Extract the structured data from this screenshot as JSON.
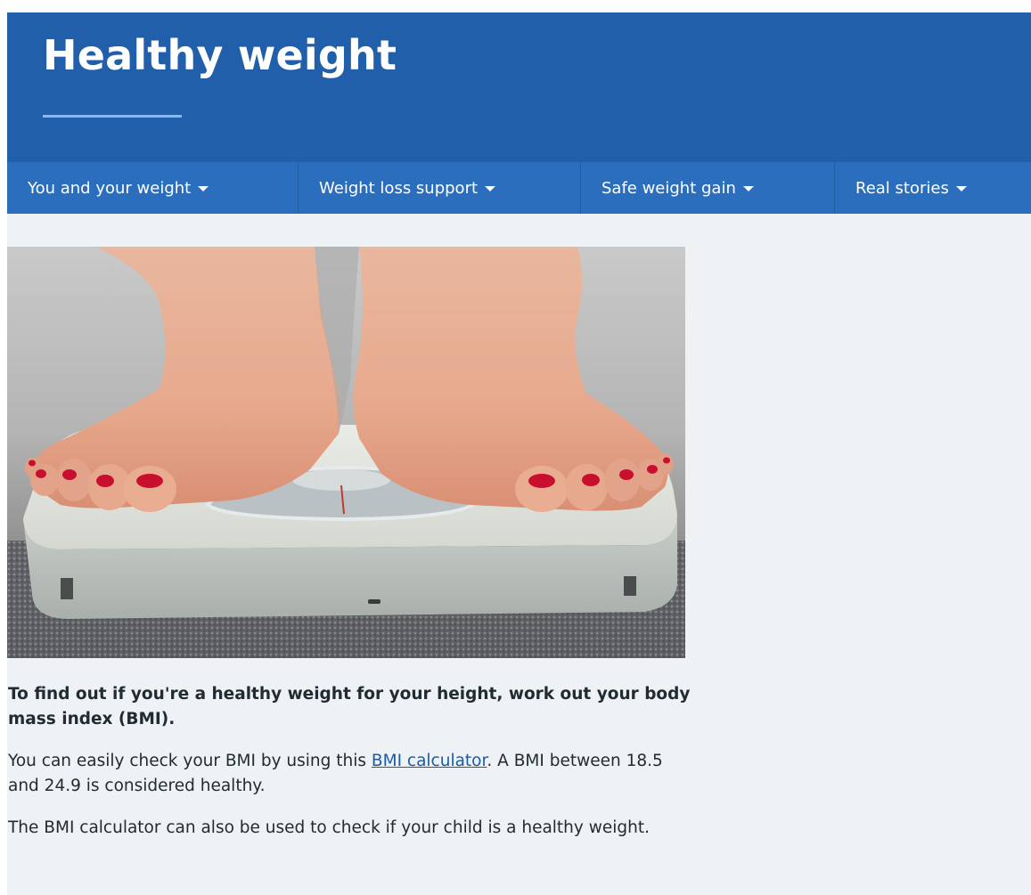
{
  "header": {
    "title": "Healthy weight"
  },
  "nav": {
    "items": [
      {
        "label": "You and your weight"
      },
      {
        "label": "Weight loss support"
      },
      {
        "label": "Safe weight gain"
      },
      {
        "label": "Real stories"
      }
    ]
  },
  "content": {
    "lead": "To find out if you're a healthy weight for your height, work out your body mass index (BMI).",
    "p1_before": "You can easily check your BMI by using this ",
    "p1_link": "BMI calculator",
    "p1_after": ". A BMI between 18.5 and 24.9 is considered healthy.",
    "p2": "The BMI calculator can also be used to check if your child is a healthy weight."
  },
  "colors": {
    "header_bg": "#225fab",
    "nav_bg": "#2a6ebd",
    "page_bg": "#eef2f4",
    "link": "#1d5aa3",
    "text": "#212b32"
  },
  "icons": {
    "nav_caret": "caret-down-icon"
  }
}
